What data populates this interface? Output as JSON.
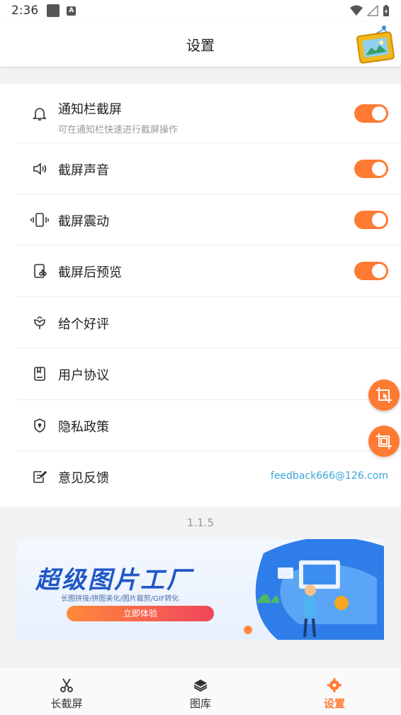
{
  "status_bar": {
    "time": "2:36"
  },
  "app_bar": {
    "title": "设置"
  },
  "settings": [
    {
      "label": "通知栏截屏",
      "sub": "可在通知栏快速进行截屏操作",
      "icon": "bell-icon",
      "toggle": true
    },
    {
      "label": "截屏声音",
      "icon": "speaker-icon",
      "toggle": true
    },
    {
      "label": "截屏震动",
      "icon": "vibrate-icon",
      "toggle": true
    },
    {
      "label": "截屏后预览",
      "icon": "preview-icon",
      "toggle": true
    },
    {
      "label": "给个好评",
      "icon": "flower-icon"
    },
    {
      "label": "用户协议",
      "icon": "document-icon"
    },
    {
      "label": "隐私政策",
      "icon": "shield-icon"
    },
    {
      "label": "意见反馈",
      "icon": "feedback-icon",
      "value": "feedback666@126.com"
    }
  ],
  "version": "1.1.5",
  "banner": {
    "title": "超级图片工厂",
    "subtitle": "长图拼接/拼图美化/图片裁剪/GIF转化",
    "button": "立即体验"
  },
  "tabs": [
    {
      "label": "长截屏",
      "icon": "scissors-icon",
      "active": false
    },
    {
      "label": "图库",
      "icon": "layers-icon",
      "active": false
    },
    {
      "label": "设置",
      "icon": "gear-icon",
      "active": true
    }
  ],
  "colors": {
    "accent": "#ff7a33",
    "link": "#3aa6d8",
    "banner_blue": "#1f57c7"
  }
}
